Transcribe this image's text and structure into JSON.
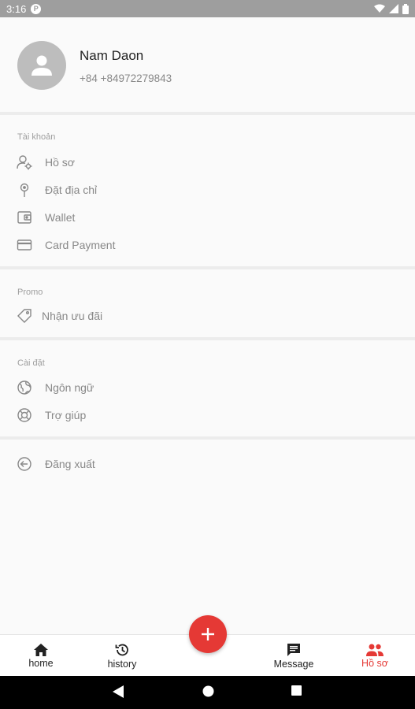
{
  "status_bar": {
    "time": "3:16",
    "notification_icon": "P",
    "icons": [
      "wifi-icon",
      "signal-icon",
      "battery-icon"
    ]
  },
  "profile": {
    "name": "Nam Daon",
    "phone": "+84 +84972279843",
    "avatar_icon": "person-icon"
  },
  "sections": {
    "account": {
      "title": "Tài khoản",
      "items": [
        {
          "label": "Hồ sơ",
          "icon": "user-settings-icon"
        },
        {
          "label": "Đặt địa chỉ",
          "icon": "location-pin-icon"
        },
        {
          "label": "Wallet",
          "icon": "wallet-icon"
        },
        {
          "label": "Card Payment",
          "icon": "credit-card-icon"
        }
      ]
    },
    "promo": {
      "title": "Promo",
      "items": [
        {
          "label": "Nhận ưu đãi",
          "icon": "tag-icon"
        }
      ]
    },
    "settings": {
      "title": "Cài đặt",
      "items": [
        {
          "label": "Ngôn ngữ",
          "icon": "globe-icon"
        },
        {
          "label": "Trợ giúp",
          "icon": "lifebuoy-icon"
        }
      ]
    },
    "logout": {
      "label": "Đăng xuất",
      "icon": "arrow-left-circle-icon"
    }
  },
  "bottom_nav": {
    "home": "home",
    "history": "history",
    "message": "Message",
    "profile": "Hồ sơ",
    "active": "profile",
    "fab_icon": "plus-icon"
  },
  "colors": {
    "accent": "#e53935",
    "background": "#fafafa",
    "status_bar": "#9e9e9e",
    "text_muted": "#888888"
  }
}
